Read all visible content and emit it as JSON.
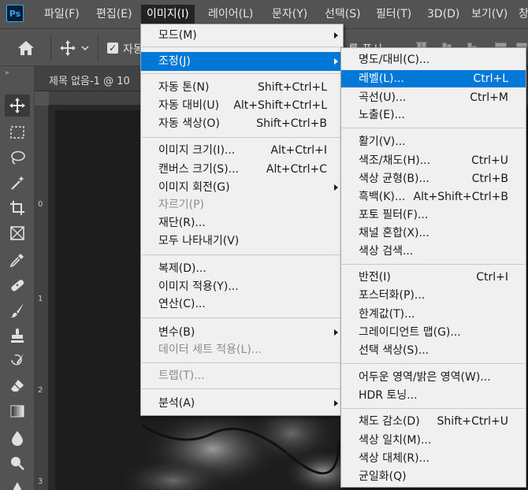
{
  "app": {
    "logo": "Ps"
  },
  "menubar": {
    "items": [
      {
        "label": "파일(F)",
        "active": false
      },
      {
        "label": "편집(E)",
        "active": false
      },
      {
        "label": "이미지(I)",
        "active": true
      },
      {
        "label": "레이어(L)",
        "active": false
      },
      {
        "label": "문자(Y)",
        "active": false
      },
      {
        "label": "선택(S)",
        "active": false
      },
      {
        "label": "필터(T)",
        "active": false
      },
      {
        "label": "3D(D)",
        "active": false
      },
      {
        "label": "보기(V)",
        "active": false
      },
      {
        "label": "창",
        "active": false
      }
    ]
  },
  "options_bar": {
    "auto_select_label": "자동",
    "show_label": "를 표시",
    "auto_select_checked": true
  },
  "document": {
    "tab_title": "제목 없음-1 @ 10",
    "ruler_left": [
      "0",
      "1",
      "2",
      "3"
    ]
  },
  "image_menu": {
    "items": [
      {
        "label": "모드(M)",
        "shortcut": "",
        "submenu": true,
        "disabled": false
      },
      {
        "label": "조정(J)",
        "shortcut": "",
        "submenu": true,
        "disabled": false,
        "highlight": true
      },
      {
        "label": "자동 톤(N)",
        "shortcut": "Shift+Ctrl+L",
        "submenu": false,
        "disabled": false
      },
      {
        "label": "자동 대비(U)",
        "shortcut": "Alt+Shift+Ctrl+L",
        "submenu": false,
        "disabled": false
      },
      {
        "label": "자동 색상(O)",
        "shortcut": "Shift+Ctrl+B",
        "submenu": false,
        "disabled": false
      },
      {
        "label": "이미지 크기(I)...",
        "shortcut": "Alt+Ctrl+I",
        "submenu": false,
        "disabled": false
      },
      {
        "label": "캔버스 크기(S)...",
        "shortcut": "Alt+Ctrl+C",
        "submenu": false,
        "disabled": false
      },
      {
        "label": "이미지 회전(G)",
        "shortcut": "",
        "submenu": true,
        "disabled": false
      },
      {
        "label": "자르기(P)",
        "shortcut": "",
        "submenu": false,
        "disabled": true
      },
      {
        "label": "재단(R)...",
        "shortcut": "",
        "submenu": false,
        "disabled": false
      },
      {
        "label": "모두 나타내기(V)",
        "shortcut": "",
        "submenu": false,
        "disabled": false
      },
      {
        "label": "복제(D)...",
        "shortcut": "",
        "submenu": false,
        "disabled": false
      },
      {
        "label": "이미지 적용(Y)...",
        "shortcut": "",
        "submenu": false,
        "disabled": false
      },
      {
        "label": "연산(C)...",
        "shortcut": "",
        "submenu": false,
        "disabled": false
      },
      {
        "label": "변수(B)",
        "shortcut": "",
        "submenu": true,
        "disabled": false
      },
      {
        "label": "데이터 세트 적용(L)...",
        "shortcut": "",
        "submenu": false,
        "disabled": true
      },
      {
        "label": "트랩(T)...",
        "shortcut": "",
        "submenu": false,
        "disabled": true
      },
      {
        "label": "분석(A)",
        "shortcut": "",
        "submenu": true,
        "disabled": false
      }
    ]
  },
  "adjust_submenu": {
    "items": [
      {
        "label": "명도/대비(C)...",
        "shortcut": "",
        "highlight": false
      },
      {
        "label": "레벨(L)...",
        "shortcut": "Ctrl+L",
        "highlight": true
      },
      {
        "label": "곡선(U)...",
        "shortcut": "Ctrl+M",
        "highlight": false
      },
      {
        "label": "노출(E)...",
        "shortcut": "",
        "highlight": false
      },
      {
        "label": "활기(V)...",
        "shortcut": "",
        "highlight": false
      },
      {
        "label": "색조/채도(H)...",
        "shortcut": "Ctrl+U",
        "highlight": false
      },
      {
        "label": "색상 균형(B)...",
        "shortcut": "Ctrl+B",
        "highlight": false
      },
      {
        "label": "흑백(K)...",
        "shortcut": "Alt+Shift+Ctrl+B",
        "highlight": false
      },
      {
        "label": "포토 필터(F)...",
        "shortcut": "",
        "highlight": false
      },
      {
        "label": "채널 혼합(X)...",
        "shortcut": "",
        "highlight": false
      },
      {
        "label": "색상 검색...",
        "shortcut": "",
        "highlight": false
      },
      {
        "label": "반전(I)",
        "shortcut": "Ctrl+I",
        "highlight": false
      },
      {
        "label": "포스터화(P)...",
        "shortcut": "",
        "highlight": false
      },
      {
        "label": "한계값(T)...",
        "shortcut": "",
        "highlight": false
      },
      {
        "label": "그레이디언트 맵(G)...",
        "shortcut": "",
        "highlight": false
      },
      {
        "label": "선택 색상(S)...",
        "shortcut": "",
        "highlight": false
      },
      {
        "label": "어두운 영역/밝은 영역(W)...",
        "shortcut": "",
        "highlight": false
      },
      {
        "label": "HDR 토닝...",
        "shortcut": "",
        "highlight": false
      },
      {
        "label": "채도 감소(D)",
        "shortcut": "Shift+Ctrl+U",
        "highlight": false
      },
      {
        "label": "색상 일치(M)...",
        "shortcut": "",
        "highlight": false
      },
      {
        "label": "색상 대체(R)...",
        "shortcut": "",
        "highlight": false
      },
      {
        "label": "균일화(Q)",
        "shortcut": "",
        "highlight": false
      }
    ]
  },
  "colors": {
    "menu_highlight": "#0078d7",
    "ps_logo": "#31a8ff",
    "ui_bg": "#535353"
  }
}
